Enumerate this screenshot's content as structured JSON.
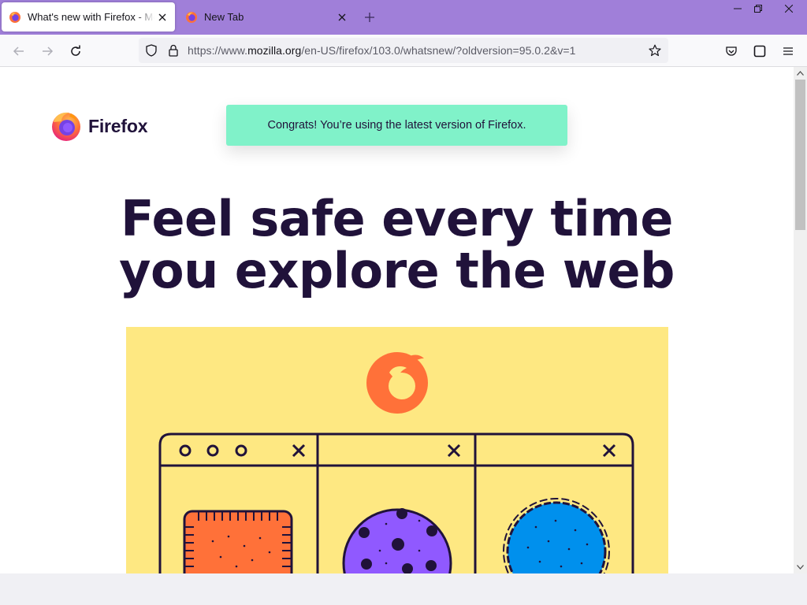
{
  "tabs": [
    {
      "title": "What's new with Firefox - More",
      "active": true
    },
    {
      "title": "New Tab",
      "active": false
    }
  ],
  "window_controls": {
    "minimize": "—",
    "restore": "❐",
    "close": "✕"
  },
  "address_bar": {
    "url_prefix": "https://www.",
    "url_host": "mozilla.org",
    "url_path": "/en-US/firefox/103.0/whatsnew/?oldversion=95.0.2&v=1"
  },
  "page": {
    "brand": "Firefox",
    "notice": "Congrats! You’re using the latest version of Firefox.",
    "headline_line1": "Feel safe every time",
    "headline_line2": "you explore the web"
  },
  "colors": {
    "tabstrip": "#a07fd9",
    "notice": "#80f2c9",
    "hero_bg": "#fee882",
    "headline": "#20123a"
  },
  "icons": [
    "firefox-favicon",
    "tab-close-icon",
    "new-tab-icon",
    "back-icon",
    "forward-icon",
    "reload-icon",
    "tracking-shield-icon",
    "lock-icon",
    "bookmark-star-icon",
    "pocket-icon",
    "sidebar-icon",
    "app-menu-icon"
  ]
}
